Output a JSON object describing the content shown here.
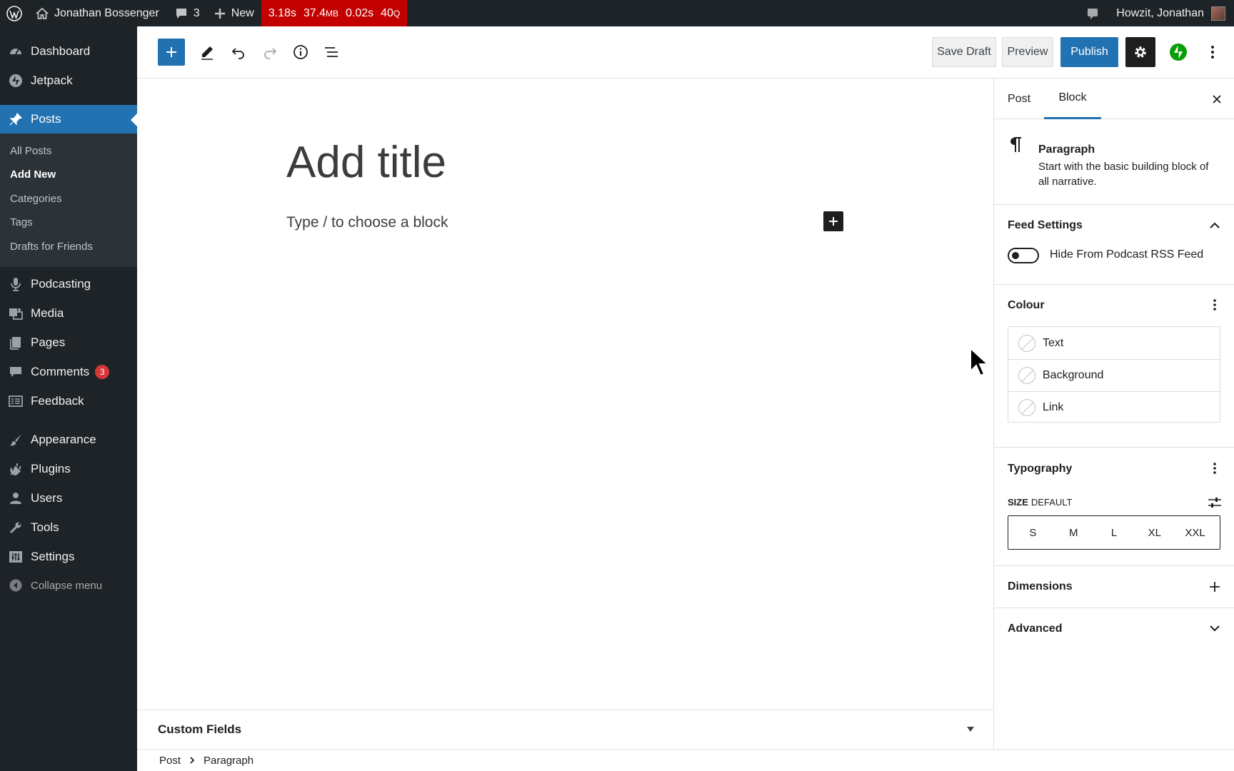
{
  "admin_bar": {
    "site_name": "Jonathan Bossenger",
    "comments_count": "3",
    "new_label": "New",
    "perf": {
      "time": "3.18s",
      "memory": "37.4",
      "memory_unit": "MB",
      "db_time": "0.02s",
      "queries": "40",
      "queries_unit": "Q"
    },
    "greeting": "Howzit, Jonathan"
  },
  "sidebar": {
    "items": [
      {
        "label": "Dashboard",
        "icon": "dashboard-icon"
      },
      {
        "label": "Jetpack",
        "icon": "jetpack-icon"
      },
      {
        "label": "Posts",
        "icon": "pin-icon",
        "current": true
      },
      {
        "label": "Podcasting",
        "icon": "microphone-icon"
      },
      {
        "label": "Media",
        "icon": "media-icon"
      },
      {
        "label": "Pages",
        "icon": "pages-icon"
      },
      {
        "label": "Comments",
        "icon": "comment-icon",
        "badge": "3"
      },
      {
        "label": "Feedback",
        "icon": "feedback-icon"
      },
      {
        "label": "Appearance",
        "icon": "brush-icon"
      },
      {
        "label": "Plugins",
        "icon": "plugin-icon"
      },
      {
        "label": "Users",
        "icon": "user-icon"
      },
      {
        "label": "Tools",
        "icon": "wrench-icon"
      },
      {
        "label": "Settings",
        "icon": "settings-icon"
      }
    ],
    "submenu": [
      "All Posts",
      "Add New",
      "Categories",
      "Tags",
      "Drafts for Friends"
    ],
    "submenu_current": "Add New",
    "collapse_label": "Collapse menu"
  },
  "header": {
    "save_draft": "Save Draft",
    "preview": "Preview",
    "publish": "Publish"
  },
  "editor": {
    "title_placeholder": "Add title",
    "paragraph_placeholder": "Type / to choose a block"
  },
  "metabox": {
    "title": "Custom Fields"
  },
  "breadcrumb": [
    "Post",
    "Paragraph"
  ],
  "settings": {
    "tabs": [
      "Post",
      "Block"
    ],
    "active_tab": "Block",
    "block": {
      "name": "Paragraph",
      "description": "Start with the basic building block of all narrative."
    },
    "feed": {
      "title": "Feed Settings",
      "toggle_label": "Hide From Podcast RSS Feed",
      "toggle_on": false
    },
    "colour": {
      "title": "Colour",
      "items": [
        "Text",
        "Background",
        "Link"
      ]
    },
    "typography": {
      "title": "Typography",
      "size_label": "SIZE",
      "size_value": "DEFAULT",
      "sizes": [
        "S",
        "M",
        "L",
        "XL",
        "XXL"
      ]
    },
    "dimensions": {
      "title": "Dimensions"
    },
    "advanced": {
      "title": "Advanced"
    }
  },
  "colors": {
    "admin_bar_bg": "#1d2327",
    "accent": "#2271b1",
    "perf_bg": "#c20000",
    "badge": "#d63638",
    "jetpack_green": "#069e08"
  }
}
